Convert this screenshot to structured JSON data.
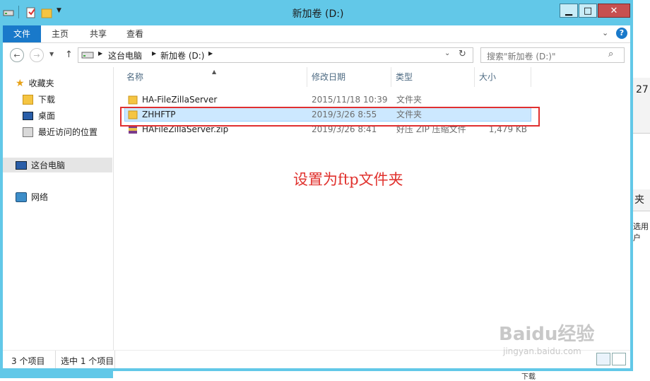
{
  "window": {
    "title": "新加卷 (D:)"
  },
  "ribbon": {
    "tabs": [
      "文件",
      "主页",
      "共享",
      "查看"
    ]
  },
  "address": {
    "crumbs": [
      "这台电脑",
      "新加卷 (D:)"
    ],
    "search_placeholder": "搜索\"新加卷 (D:)\""
  },
  "nav": {
    "favorites": "收藏夹",
    "favorites_items": [
      "下载",
      "桌面",
      "最近访问的位置"
    ],
    "this_pc": "这台电脑",
    "network": "网络"
  },
  "columns": [
    "名称",
    "修改日期",
    "类型",
    "大小"
  ],
  "files": [
    {
      "name": "HA-FileZillaServer",
      "date": "2015/11/18 10:39",
      "type": "文件夹",
      "size": "",
      "icon": "folder-icon"
    },
    {
      "name": "ZHHFTP",
      "date": "2019/3/26 8:55",
      "type": "文件夹",
      "size": "",
      "icon": "folder-icon"
    },
    {
      "name": "HAFileZillaServer.zip",
      "date": "2019/3/26 8:41",
      "type": "好压 ZIP 压缩文件",
      "size": "1,479 KB",
      "icon": "zip-archive-icon"
    }
  ],
  "annotation": "设置为ftp文件夹",
  "status": {
    "count": "3 个项目",
    "selected": "选中 1 个项目"
  },
  "background_window": {
    "items": [
      "27",
      "夹",
      "选用户",
      "下载"
    ]
  },
  "watermark": {
    "brand": "Baidu经验",
    "url": "jingyan.baidu.com"
  },
  "colors": {
    "frame": "#62c8e8",
    "file_tab": "#1979ca",
    "selection": "#cce8ff",
    "annotation": "#e0312d"
  }
}
